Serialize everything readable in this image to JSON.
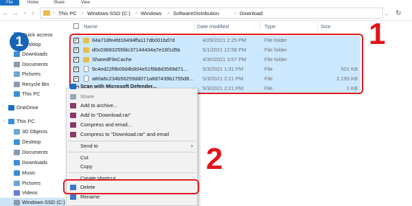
{
  "ribbon": {
    "file": "File",
    "tabs": [
      "Home",
      "Share",
      "View"
    ]
  },
  "address": {
    "crumbs": [
      "This PC",
      "Windows-SSD (C:)",
      "Windows",
      "SoftwareDistribution",
      "Download"
    ]
  },
  "sidebar": {
    "items": [
      {
        "label": "Quick access",
        "icon": "star-icon",
        "color": "#3a78c8"
      },
      {
        "label": "Desktop",
        "icon": "desktop-icon",
        "color": "#3a8fd9"
      },
      {
        "label": "Downloads",
        "icon": "download-icon",
        "color": "#3a8fd9"
      },
      {
        "label": "Documents",
        "icon": "documents-icon",
        "color": "#8a9bb0"
      },
      {
        "label": "Pictures",
        "icon": "pictures-icon",
        "color": "#6aa7d8"
      },
      {
        "label": "Recycle Bin",
        "icon": "recycle-bin-icon",
        "color": "#8a9bb0"
      },
      {
        "label": "This PC",
        "icon": "computer-icon",
        "color": "#3a8fd9"
      },
      {
        "label": "OneDrive",
        "icon": "cloud-icon",
        "color": "#1a6fc4"
      },
      {
        "label": "This PC",
        "icon": "computer-icon",
        "color": "#3a8fd9"
      },
      {
        "label": "3D Objects",
        "icon": "cube-icon",
        "color": "#6aa7d8"
      },
      {
        "label": "Desktop",
        "icon": "desktop-icon",
        "color": "#3a8fd9"
      },
      {
        "label": "Documents",
        "icon": "documents-icon",
        "color": "#8a9bb0"
      },
      {
        "label": "Downloads",
        "icon": "download-icon",
        "color": "#3a8fd9"
      },
      {
        "label": "Music",
        "icon": "music-icon",
        "color": "#3a8fd9"
      },
      {
        "label": "Pictures",
        "icon": "pictures-icon",
        "color": "#6aa7d8"
      },
      {
        "label": "Videos",
        "icon": "videos-icon",
        "color": "#6a7bd8"
      },
      {
        "label": "Windows-SSD (C:)",
        "icon": "drive-icon",
        "color": "#8a9bb0"
      }
    ]
  },
  "columns": {
    "name": "Name",
    "date": "Date modified",
    "type": "Type",
    "size": "Size"
  },
  "files": [
    {
      "name": "64a718fe4fd16494ffa117db001bd7d",
      "date": "4/29/2021 2:25 PM",
      "type": "File folder",
      "size": "",
      "kind": "folder"
    },
    {
      "name": "d0c03683255fdc37144434a7e16f1d5b",
      "date": "5/1/2021 12:58 PM",
      "type": "File folder",
      "size": "",
      "kind": "folder"
    },
    {
      "name": "SharedFileCache",
      "date": "4/30/2021 3:57 PM",
      "type": "File folder",
      "size": "",
      "kind": "folder"
    },
    {
      "name": "9c4ed22f9b09d4b904e51f9b8d3569d71...",
      "date": "5/3/2021 1:31 PM",
      "type": "File",
      "size": "501 KB",
      "kind": "file"
    },
    {
      "name": "a80a6c234b56259dd071a8d7439b1755d8...",
      "date": "5/3/2021 2:21 PM",
      "type": "File",
      "size": "2,193 KB",
      "kind": "file"
    },
    {
      "name": "",
      "date": "5/3/2021 2:21 PM",
      "type": "File",
      "size": "1 KB",
      "kind": "file"
    }
  ],
  "menu": {
    "items": [
      {
        "label": "Scan with Microsoft Defender...",
        "icon": "defender-icon",
        "bold": true
      },
      {
        "label": "Share",
        "icon": "share-icon"
      },
      {
        "label": "Add to archive...",
        "icon": "archive-icon"
      },
      {
        "label": "Add to \"Download.rar\"",
        "icon": "archive-icon"
      },
      {
        "label": "Compress and email...",
        "icon": "archive-icon"
      },
      {
        "label": "Compress to \"Download.rar\" and email",
        "icon": "archive-icon"
      },
      {
        "label": "Send to",
        "icon": "",
        "arrow": true
      },
      {
        "label": "Cut",
        "icon": ""
      },
      {
        "label": "Copy",
        "icon": ""
      },
      {
        "label": "Create shortcut",
        "icon": ""
      },
      {
        "label": "Delete",
        "icon": "shield-icon"
      },
      {
        "label": "Rename",
        "icon": "shield-icon"
      }
    ]
  },
  "annotations": {
    "step1": "1",
    "step2": "2",
    "badge": "1"
  },
  "colors": {
    "accent": "#1a6fc4",
    "highlight": "#cce8ff",
    "callout": "#e1141b"
  }
}
